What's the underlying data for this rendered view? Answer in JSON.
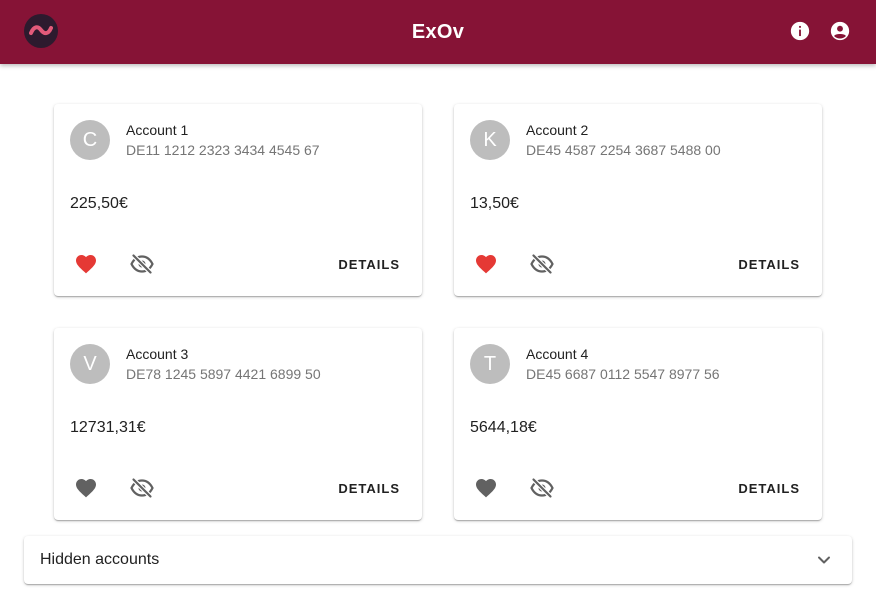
{
  "app": {
    "title": "ExOv",
    "icons": {
      "logo": "tilde-logo-icon",
      "info": "info-icon",
      "account": "account-circle-icon"
    },
    "colors": {
      "primary": "#861336",
      "favorite_on": "#e53935",
      "favorite_off": "#616161",
      "avatar": "#bdbdbd"
    }
  },
  "accounts": [
    {
      "initial": "C",
      "name": "Account 1",
      "iban": "DE11 1212 2323 3434 4545 67",
      "balance": "225,50€",
      "favorite": true,
      "details_label": "DETAILS"
    },
    {
      "initial": "K",
      "name": "Account 2",
      "iban": "DE45 4587 2254 3687 5488 00",
      "balance": "13,50€",
      "favorite": true,
      "details_label": "DETAILS"
    },
    {
      "initial": "V",
      "name": "Account 3",
      "iban": "DE78 1245 5897 4421 6899 50",
      "balance": "12731,31€",
      "favorite": false,
      "details_label": "DETAILS"
    },
    {
      "initial": "T",
      "name": "Account 4",
      "iban": "DE45 6687 0112 5547 8977 56",
      "balance": "5644,18€",
      "favorite": false,
      "details_label": "DETAILS"
    }
  ],
  "hidden_panel": {
    "label": "Hidden accounts",
    "icon": "chevron-down-icon"
  }
}
